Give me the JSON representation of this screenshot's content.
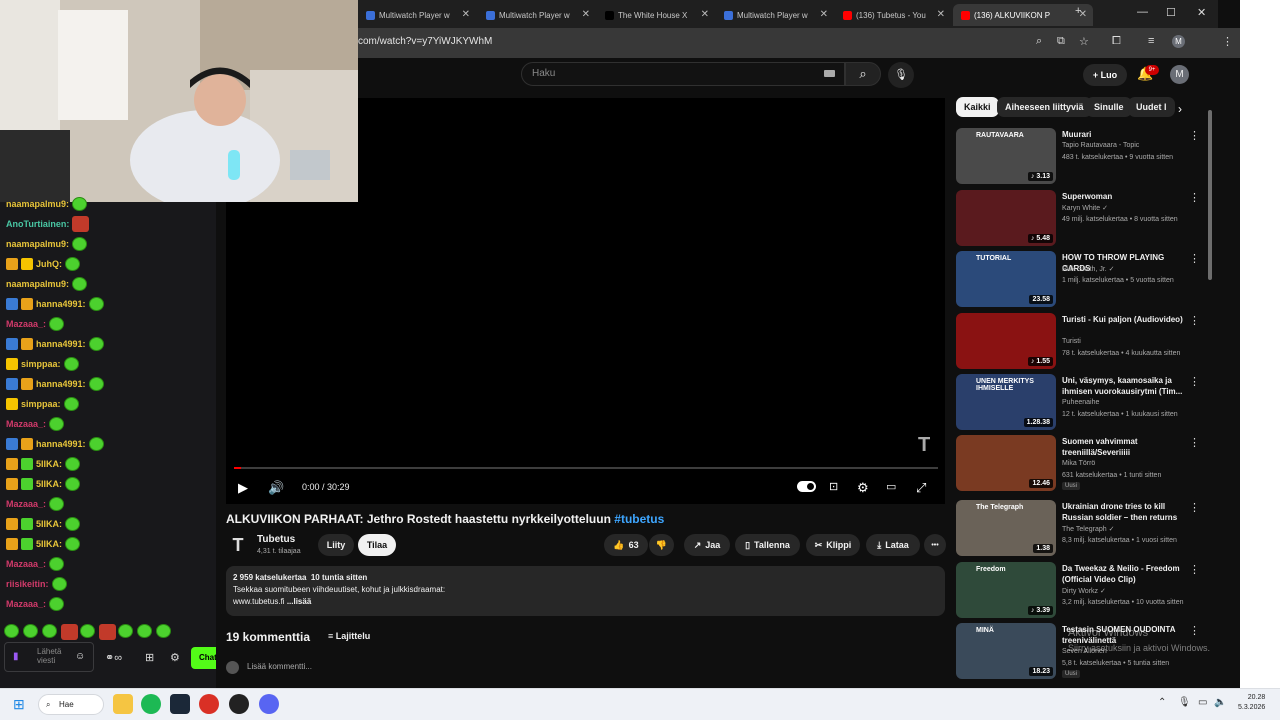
{
  "browser": {
    "tabs": [
      {
        "label": "Multiwatch Player w",
        "favicon_color": "#3b6fd8"
      },
      {
        "label": "Multiwatch Player w",
        "favicon_color": "#3b6fd8"
      },
      {
        "label": "The White House X",
        "favicon_color": "#000000",
        "icon": "x-logo-icon"
      },
      {
        "label": "Multiwatch Player w",
        "favicon_color": "#3b6fd8"
      },
      {
        "label": "(136) Tubetus - You",
        "favicon_color": "#ff0000"
      },
      {
        "label": "(136) ALKUVIIKON P",
        "favicon_color": "#ff0000"
      }
    ],
    "new_tab": "+",
    "url": "com/watch?v=y7YiWJKYWhM",
    "profile_initial": "M"
  },
  "youtube": {
    "search_placeholder": "Haku",
    "create_label": "Luo",
    "notification_count": "9+",
    "avatar_initial": "M"
  },
  "player": {
    "time": "0:00 / 30:29",
    "progress": 0.01
  },
  "video": {
    "title": "ALKUVIIKON PARHAAT: Jethro Rostedt haastettu nyrkkeilyotteluun",
    "hashtag": "#tubetus",
    "channel_name": "Tubetus",
    "channel_subs": "4,31 t. tilaajaa",
    "join_label": "Liity",
    "subscribe_label": "Tilaa",
    "likes": "63",
    "share_label": "Jaa",
    "save_label": "Tallenna",
    "clip_label": "Klippi",
    "download_label": "Lataa",
    "more_label": "•••",
    "desc_views": "2 959 katselukertaa",
    "desc_age": "10 tuntia sitten",
    "desc_line1": "Tsekkaa suomitubeen viihdeuutiset, kohut ja julkkisdraamat:",
    "desc_line2": "www.tubetus.fi",
    "desc_more": "...lisää"
  },
  "comments": {
    "count_label": "19 kommenttia",
    "sort_label": "Lajittelu",
    "add_placeholder": "Lisää kommentti..."
  },
  "chips": [
    "Kaikki",
    "Aiheeseen liittyviä",
    "Sinulle",
    "Uudet l"
  ],
  "recommendations": [
    {
      "title": "Muurari",
      "channel": "Tapio Rautavaara - Topic",
      "meta": "483 t. katselukertaa • 9 vuotta sitten",
      "duration": "♪ 3.13",
      "thumb_color": "#4a4a4a",
      "thumb_text": "RAUTAVAARA"
    },
    {
      "title": "Superwoman",
      "channel": "Karyn White ✓",
      "meta": "49 milj. katselukertaa • 8 vuotta sitten",
      "duration": "♪ 5.48",
      "thumb_color": "#5a1a1e",
      "thumb_text": ""
    },
    {
      "title": "HOW TO THROW PLAYING CARDS",
      "channel": "Rick Smith, Jr. ✓",
      "meta": "1 milj. katselukertaa • 5 vuotta sitten",
      "duration": "23.58",
      "thumb_color": "#2b4a7a",
      "thumb_text": "TUTORIAL"
    },
    {
      "title": "Turisti - Kui paljon (Audiovideo)",
      "channel": "Turisti",
      "meta": "78 t. katselukertaa • 4 kuukautta sitten",
      "duration": "♪ 1.55",
      "thumb_color": "#8a1212",
      "thumb_text": ""
    },
    {
      "title": "Uni, väsymys, kaamosaika ja ihmisen vuorokausirytmi (Tim...",
      "channel": "Puheenaihe",
      "meta": "12 t. katselukertaa • 1 kuukausi sitten",
      "duration": "1.28.38",
      "thumb_color": "#2a3f6b",
      "thumb_text": "UNEN MERKITYS IHMISELLE"
    },
    {
      "title": "Suomen vahvimmat treeniillä/Severiiiii",
      "channel": "Mika Törrö",
      "meta": "631 katselukertaa • 1 tunti sitten",
      "duration": "12.46",
      "thumb_color": "#7a3a22",
      "thumb_text": "",
      "badge": "Uusi"
    },
    {
      "title": "Ukrainian drone tries to kill Russian soldier – then returns ...",
      "channel": "The Telegraph ✓",
      "meta": "8,3 milj. katselukertaa • 1 vuosi sitten",
      "duration": "1.38",
      "thumb_color": "#6a6258",
      "thumb_text": "The Telegraph"
    },
    {
      "title": "Da Tweekaz & Neilio - Freedom (Official Video Clip)",
      "channel": "Dirty Workz ✓",
      "meta": "3,2 milj. katselukertaa • 10 vuotta sitten",
      "duration": "♪ 3.39",
      "thumb_color": "#2f4a3a",
      "thumb_text": "Freedom"
    },
    {
      "title": "Testasin SUOMEN OUDOINTA treenivälinettä",
      "channel": "Seven Allonen",
      "meta": "5,8 t. katselukertaa • 5 tuntia sitten",
      "duration": "18.23",
      "thumb_color": "#3a4a5a",
      "thumb_text": "MINÄ",
      "badge": "Uusi"
    }
  ],
  "windows_notice": {
    "line1": "Aktivoi Windows",
    "line2": "Siirry asetuksiin ja aktivoi Windows."
  },
  "chat": {
    "messages": [
      {
        "user": "naamapalmu9:",
        "color": "#e8c53a",
        "badges": []
      },
      {
        "user": "AnoTurtiainen:",
        "color": "#49c6a3",
        "badges": [],
        "emote": "red"
      },
      {
        "user": "naamapalmu9:",
        "color": "#e8c53a",
        "badges": []
      },
      {
        "user": "JuhQ:",
        "color": "#e8c53a",
        "badges": [
          "#e8a21a",
          "#f5c400"
        ]
      },
      {
        "user": "naamapalmu9:",
        "color": "#e8c53a",
        "badges": []
      },
      {
        "user": "hanna4991:",
        "color": "#e8c53a",
        "badges": [
          "#3a7bd5",
          "#e8a21a"
        ]
      },
      {
        "user": "Mazaaa_:",
        "color": "#d13a6a",
        "badges": []
      },
      {
        "user": "hanna4991:",
        "color": "#e8c53a",
        "badges": [
          "#3a7bd5",
          "#e8a21a"
        ]
      },
      {
        "user": "simppaa:",
        "color": "#e8c53a",
        "badges": [
          "#f5c400"
        ]
      },
      {
        "user": "hanna4991:",
        "color": "#e8c53a",
        "badges": [
          "#3a7bd5",
          "#e8a21a"
        ]
      },
      {
        "user": "simppaa:",
        "color": "#e8c53a",
        "badges": [
          "#f5c400"
        ]
      },
      {
        "user": "Mazaaa_:",
        "color": "#d13a6a",
        "badges": []
      },
      {
        "user": "hanna4991:",
        "color": "#e8c53a",
        "badges": [
          "#3a7bd5",
          "#e8a21a"
        ]
      },
      {
        "user": "5IIKA:",
        "color": "#e8c53a",
        "badges": [
          "#e8a21a",
          "#4cd12e"
        ]
      },
      {
        "user": "5IIKA:",
        "color": "#e8c53a",
        "badges": [
          "#e8a21a",
          "#4cd12e"
        ]
      },
      {
        "user": "Mazaaa_:",
        "color": "#d13a6a",
        "badges": []
      },
      {
        "user": "5IIKA:",
        "color": "#e8c53a",
        "badges": [
          "#e8a21a",
          "#4cd12e"
        ]
      },
      {
        "user": "5IIKA:",
        "color": "#e8c53a",
        "badges": [
          "#e8a21a",
          "#4cd12e"
        ]
      },
      {
        "user": "Mazaaa_:",
        "color": "#d13a6a",
        "badges": []
      },
      {
        "user": "riisikeitin:",
        "color": "#d13a6a",
        "badges": []
      },
      {
        "user": "Mazaaa_:",
        "color": "#d13a6a",
        "badges": []
      }
    ],
    "input_placeholder": "Lähetä viesti",
    "send_label": "Chat"
  },
  "taskbar": {
    "search_label": "Hae",
    "time": "20.28",
    "date": "5.3.2026"
  }
}
